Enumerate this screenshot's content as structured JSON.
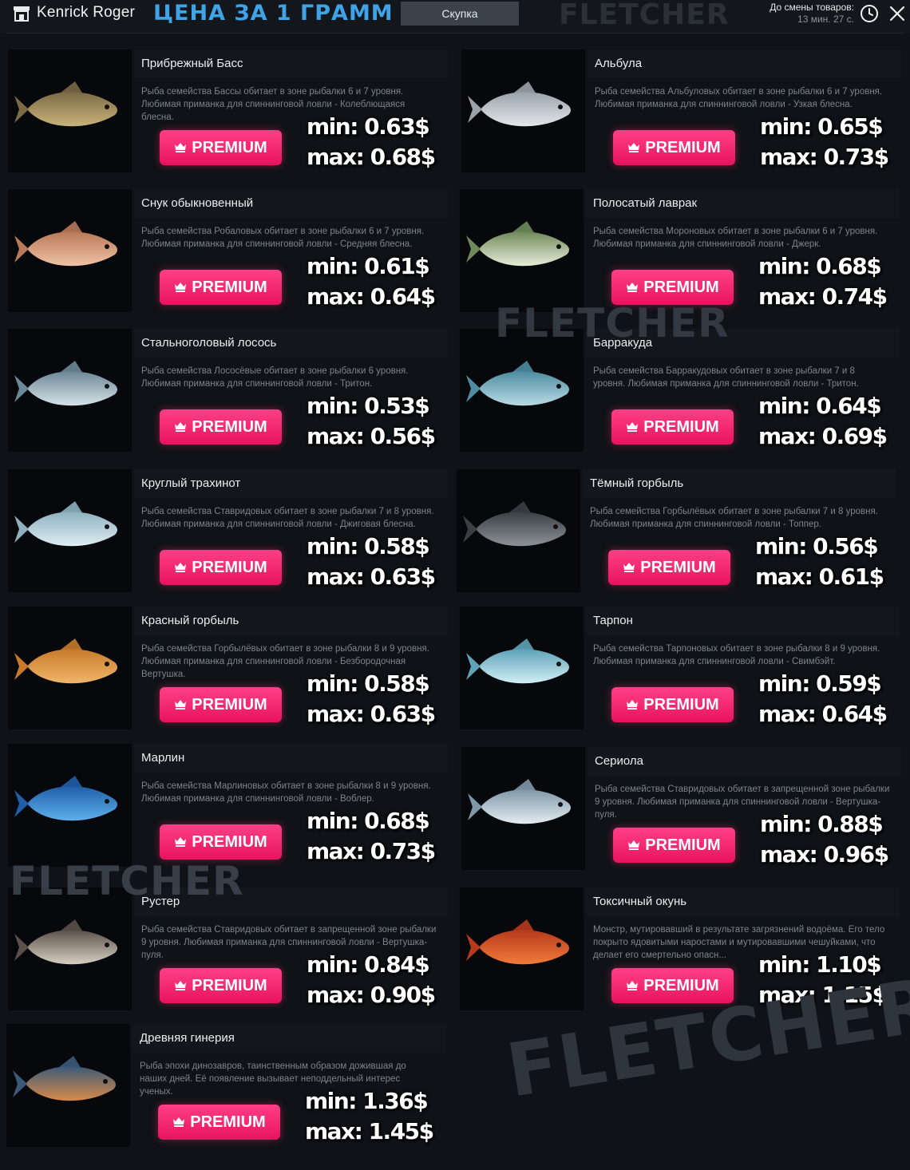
{
  "header": {
    "user_name": "Kenrick Roger",
    "title": "ЦЕНА ЗА 1 ГРАММ",
    "tab_label": "Скупка",
    "watermark": "FLETCHER",
    "timer_label": "До смены товаров:",
    "timer_value": "13 мин. 27 с.",
    "icons": [
      "store-icon",
      "clock-icon",
      "close-icon"
    ]
  },
  "accent_color": "#ff2d78",
  "title_color": "#3fa3e8",
  "premium_label": "PREMIUM",
  "watermark_text": "FLETCHER",
  "fish": [
    {
      "name": "Прибрежный Басс",
      "desc": "Рыба семейства Бассы обитает в зоне рыбалки 6 и 7 уровня. Любимая приманка для спиннинговой ловли - Колеблющаяся блесна.",
      "min": "min: 0.63$",
      "max": "max: 0.68$",
      "colors": [
        "#7a6a45",
        "#c9b27a"
      ]
    },
    {
      "name": "Альбула",
      "desc": "Рыба семейства Альбуловых обитает в зоне рыбалки 6 и 7 уровня. Любимая приманка для спиннинговой ловли - Узкая блесна.",
      "min": "min: 0.65$",
      "max": "max: 0.73$",
      "colors": [
        "#9aa3ab",
        "#e3e6e9"
      ]
    },
    {
      "name": "Снук обыкновенный",
      "desc": "Рыба семейства Робаловых обитает в зоне рыбалки 6 и 7 уровня. Любимая приманка для спиннинговой ловли - Средняя блесна.",
      "min": "min: 0.61$",
      "max": "max: 0.64$",
      "colors": [
        "#b9795a",
        "#f0c2a5"
      ]
    },
    {
      "name": "Полосатый лаврак",
      "desc": "Рыба семейства Мороновых обитает в зоне рыбалки 6 и 7 уровня. Любимая приманка для спиннинговой ловли - Джерк.",
      "min": "min: 0.68$",
      "max": "max: 0.74$",
      "colors": [
        "#6f8a5a",
        "#e6ecd8"
      ]
    },
    {
      "name": "Стальноголовый лосось",
      "desc": "Рыба семейства Лососёвые обитает в зоне рыбалки 6 уровня. Любимая приманка для спиннинговой ловли - Тритон.",
      "min": "min: 0.53$",
      "max": "max: 0.56$",
      "colors": [
        "#6d8896",
        "#d6e2e8"
      ]
    },
    {
      "name": "Барракуда",
      "desc": "Рыба семейства Барракудовых обитает в зоне рыбалки 7 и 8 уровня. Любимая приманка для спиннинговой ловли - Тритон.",
      "min": "min: 0.64$",
      "max": "max: 0.69$",
      "colors": [
        "#4e8ca0",
        "#b8dbe6"
      ]
    },
    {
      "name": "Круглый трахинот",
      "desc": "Рыба семейства Ставридовых обитает в зоне рыбалки 7 и 8 уровня. Любимая приманка для спиннинговой ловли - Джиговая блесна.",
      "min": "min: 0.58$",
      "max": "max: 0.63$",
      "colors": [
        "#8fb1bf",
        "#dfeef3"
      ]
    },
    {
      "name": "Тёмный горбыль",
      "desc": "Рыба семейства Горбылёвых обитает в зоне рыбалки 7 и 8 уровня. Любимая приманка для спиннинговой ловли - Топпер.",
      "min": "min: 0.56$",
      "max": "max: 0.61$",
      "colors": [
        "#3a3f44",
        "#8c9297"
      ]
    },
    {
      "name": "Красный горбыль",
      "desc": "Рыба семейства Горбылёвых обитает в зоне рыбалки 8 и 9 уровня. Любимая приманка для спиннинговой ловли - Безбородочная Вертушка.",
      "min": "min: 0.58$",
      "max": "max: 0.63$",
      "colors": [
        "#c77a2a",
        "#f0b66a"
      ]
    },
    {
      "name": "Тарпон",
      "desc": "Рыба семейства Тарпоновых обитает в зоне рыбалки 8 и 9 уровня. Любимая приманка для спиннинговой ловли - Свимбэйт.",
      "min": "min: 0.59$",
      "max": "max: 0.64$",
      "colors": [
        "#5ea3b8",
        "#d3eef5"
      ]
    },
    {
      "name": "Марлин",
      "desc": "Рыба семейства Марлиновых обитает в зоне рыбалки 8 и 9 уровня. Любимая приманка для спиннинговой ловли - Воблер.",
      "min": "min: 0.68$",
      "max": "max: 0.73$",
      "colors": [
        "#1f5fa8",
        "#5fb0ec"
      ]
    },
    {
      "name": "Сериола",
      "desc": "Рыба семейства Ставридовых обитает в запрещенной зоне рыбалки 9 уровня. Любимая приманка для спиннинговой ловли - Вертушка-пуля.",
      "min": "min: 0.88$",
      "max": "max: 0.96$",
      "colors": [
        "#7f98a8",
        "#e4ecf1"
      ]
    },
    {
      "name": "Рустер",
      "desc": "Рыба семейства Ставридовых обитает в запрещенной зоне рыбалки 9 уровня. Любимая приманка для спиннинговой ловли - Вертушка-пуля.",
      "min": "min: 0.84$",
      "max": "max: 0.90$",
      "colors": [
        "#5b5148",
        "#d8cfc4"
      ]
    },
    {
      "name": "Токсичный окунь",
      "desc": "Монстр, мутировавший в результате загрязнений водоёма. Его тело покрыто ядовитыми наростами и мутировавшими чешуйками, что делает его смертельно опасн...",
      "min": "min: 1.10$",
      "max": "max: 1.15$",
      "colors": [
        "#b83a1c",
        "#f07a3a"
      ]
    },
    {
      "name": "Древняя гинерия",
      "desc": "Рыба эпохи динозавров, таинственным образом дожившая до наших дней. Её появление вызывает неподдельный интерес ученых.",
      "min": "min: 1.36$",
      "max": "max: 1.45$",
      "colors": [
        "#3b5a78",
        "#d98a4a"
      ]
    }
  ]
}
